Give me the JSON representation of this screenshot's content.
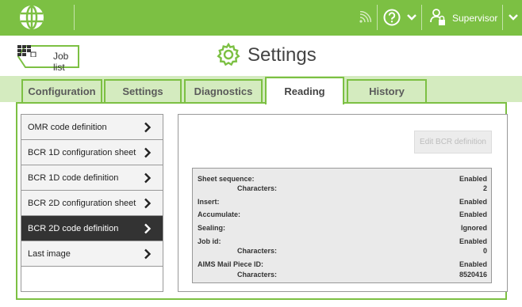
{
  "topbar": {
    "user_label": "Supervisor",
    "icons": [
      "logo-globe-icon",
      "wifi-signal-icon",
      "help-icon",
      "chevron-down-icon",
      "user-lock-icon",
      "chevron-down-icon"
    ],
    "color": "#7cc043"
  },
  "header": {
    "back_label": "Job list",
    "back_icon": "job-list-icon",
    "title": "Settings",
    "title_icon": "gear-icon"
  },
  "tabs": [
    {
      "label": "Configuration",
      "active": false
    },
    {
      "label": "Settings",
      "active": false
    },
    {
      "label": "Diagnostics",
      "active": false
    },
    {
      "label": "Reading",
      "active": true
    },
    {
      "label": "History",
      "active": false
    }
  ],
  "sidebar": {
    "items": [
      {
        "label": "OMR code definition",
        "active": false
      },
      {
        "label": "BCR 1D configuration sheet",
        "active": false
      },
      {
        "label": "BCR 1D code definition",
        "active": false
      },
      {
        "label": "BCR 2D configuration sheet",
        "active": false
      },
      {
        "label": "BCR 2D code definition",
        "active": true
      },
      {
        "label": "Last image",
        "active": false
      }
    ]
  },
  "panel": {
    "edit_button_label": "Edit BCR definition",
    "edit_button_enabled": false,
    "rows": [
      {
        "key": "Sheet sequence:",
        "value": "Enabled",
        "sub": false
      },
      {
        "key": "Characters:",
        "value": "2",
        "sub": true
      },
      {
        "key": "Insert:",
        "value": "Enabled",
        "sub": false
      },
      {
        "key": "Accumulate:",
        "value": "Enabled",
        "sub": false
      },
      {
        "key": "Sealing:",
        "value": "Ignored",
        "sub": false
      },
      {
        "key": "Job id:",
        "value": "Enabled",
        "sub": false
      },
      {
        "key": "Characters:",
        "value": "0",
        "sub": true
      },
      {
        "key": "AIMS Mail Piece ID:",
        "value": "Enabled",
        "sub": false
      },
      {
        "key": "Characters:",
        "value": "8520416",
        "sub": true
      }
    ]
  }
}
